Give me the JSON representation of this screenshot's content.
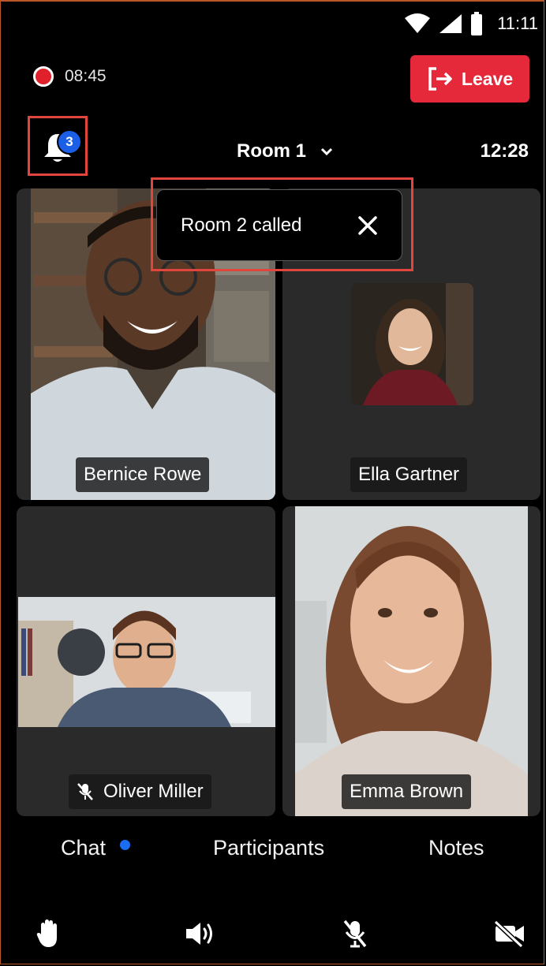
{
  "status_bar": {
    "time": "11:11",
    "icons": [
      "wifi-icon",
      "signal-icon",
      "battery-icon"
    ]
  },
  "recording": {
    "elapsed": "08:45",
    "color": "#e0202a"
  },
  "leave_button": {
    "label": "Leave",
    "icon": "exit-icon",
    "color": "#e5283a"
  },
  "notifications": {
    "badge_count": "3",
    "badge_color": "#1a5fe6"
  },
  "room": {
    "name": "Room 1",
    "time": "12:28"
  },
  "toast": {
    "message": "Room 2 called"
  },
  "participants": [
    {
      "name": "Bernice Rowe",
      "muted": false
    },
    {
      "name": "Ella Gartner",
      "muted": false
    },
    {
      "name": "Oliver Miller",
      "muted": true
    },
    {
      "name": "Emma Brown",
      "muted": false
    }
  ],
  "tabs": [
    {
      "label": "Chat",
      "has_unread": true
    },
    {
      "label": "Participants"
    },
    {
      "label": "Notes"
    }
  ],
  "controls": [
    "raise-hand-icon",
    "speaker-icon",
    "mic-off-icon",
    "camera-off-icon"
  ],
  "highlight_color": "#e0453e"
}
